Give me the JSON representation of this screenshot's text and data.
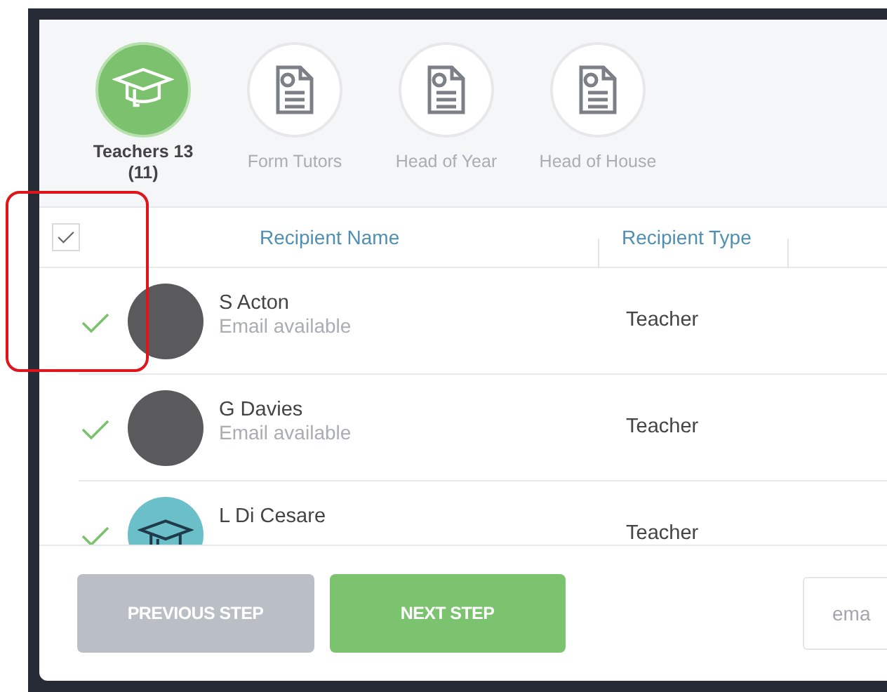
{
  "tabs": [
    {
      "label": "Teachers 13 (11)",
      "selected": true,
      "kind": "cap"
    },
    {
      "label": "Form Tutors",
      "selected": false,
      "kind": "document"
    },
    {
      "label": "Head of Year",
      "selected": false,
      "kind": "document"
    },
    {
      "label": "Head of House",
      "selected": false,
      "kind": "document"
    }
  ],
  "table": {
    "select_all": {
      "checked": true
    },
    "columns": [
      "Recipient Name",
      "Recipient Type"
    ],
    "rows": [
      {
        "name": "S Acton",
        "detail": "Email available",
        "type": "Teacher",
        "checked": true,
        "kind": "photo"
      },
      {
        "name": "G Davies",
        "detail": "Email available",
        "type": "Teacher",
        "checked": true,
        "kind": "photo"
      },
      {
        "name": "L Di Cesare",
        "type": "Teacher",
        "checked": true,
        "kind": "icon"
      }
    ]
  },
  "footer": {
    "buttons": [
      {
        "label": "PREVIOUS STEP",
        "disabled": true
      },
      {
        "label": "NEXT STEP",
        "disabled": false
      }
    ],
    "email_field": {
      "placeholder": "ema"
    }
  },
  "annotation": {
    "kind": "highlight"
  }
}
